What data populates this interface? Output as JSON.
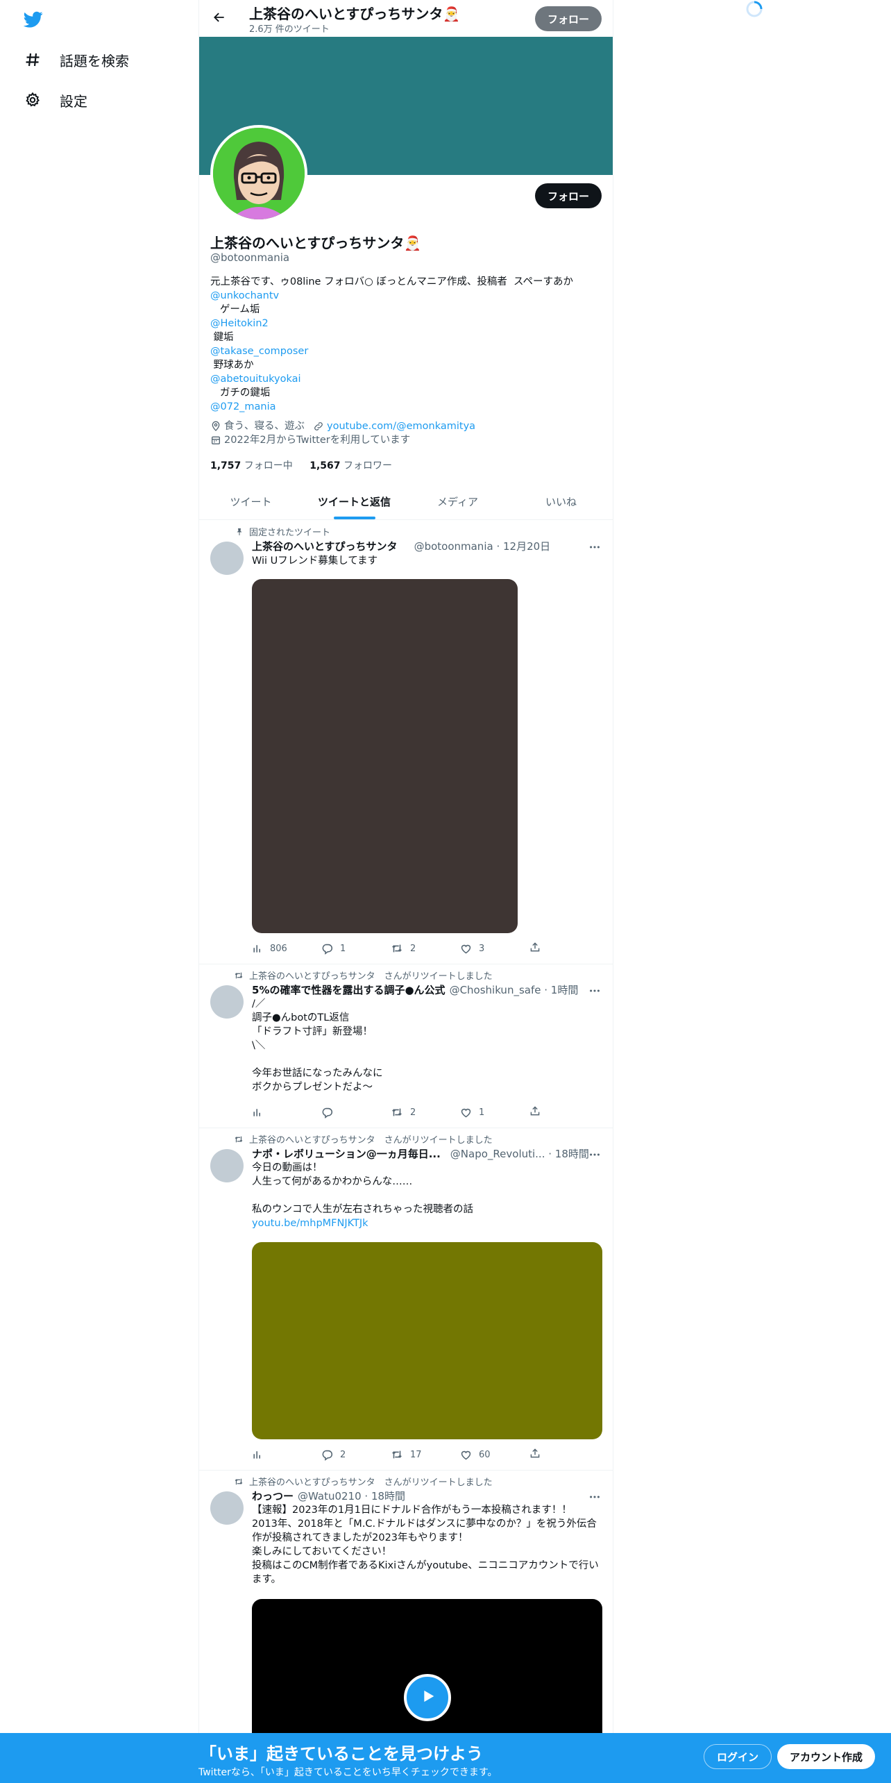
{
  "nav": {
    "items": [
      {
        "label": "話題を検索",
        "icon": "hashtag-icon"
      },
      {
        "label": "設定",
        "icon": "gear-icon"
      }
    ]
  },
  "header": {
    "name": "上茶谷のへいとすぴっちサンタ🎅",
    "tweet_count": "2.6万 件のツイート",
    "follow_label": "フォロー"
  },
  "profile": {
    "follow_label": "フォロー",
    "name": "上茶谷のへいとすぴっちサンタ🎅",
    "handle": "@botoonmania",
    "bio": {
      "line1": "元上茶谷です、ゥ08line フォロバ○ ぼっとんマニア作成、投稿者  スペーすあか",
      "link1": "@unkochantv",
      "text1": "   ゲーム垢",
      "link2": "@Heitokin2",
      "text2": " 鍵垢",
      "link3": "@takase_composer",
      "text3": " 野球あか",
      "link4": "@abetouitukyokai",
      "text4": "   ガチの鍵垢",
      "link5": "@072_mania"
    },
    "location": "食う、寝る、遊ぶ",
    "url": "youtube.com/@emonkamitya",
    "joined": "2022年2月からTwitterを利用しています",
    "following_count": "1,757",
    "following_label": "フォロー中",
    "followers_count": "1,567",
    "followers_label": "フォロワー"
  },
  "tabs": [
    {
      "label": "ツイート",
      "active": false
    },
    {
      "label": "ツイートと返信",
      "active": true
    },
    {
      "label": "メディア",
      "active": false
    },
    {
      "label": "いいね",
      "active": false
    }
  ],
  "tweets": [
    {
      "context": "固定されたツイート",
      "name": "上茶谷のへいとすぴっちサンタ",
      "handle": "@botoonmania",
      "time": "12月20日",
      "lines": [
        "Wii Uフレンド募集してます"
      ],
      "media_color": "#3e3533",
      "views": "806",
      "replies": "1",
      "retweets": "2",
      "likes": "3"
    },
    {
      "context": "上茶谷のへいとすぴっちサンタ　さんがリツイートしました",
      "name": "5%の確率で性器を露出する調子●ん公式",
      "handle": "@Choshikun_safe",
      "time": "1時間",
      "lines": [
        "/／",
        "調子●んbotのTL返信",
        "「ドラフト寸評」新登場！",
        "\\＼",
        "",
        "今年お世話になったみんなに",
        "ボクからプレゼントだよ〜"
      ],
      "views": "",
      "replies": "",
      "retweets": "2",
      "likes": "1"
    },
    {
      "context": "上茶谷のへいとすぴっちサンタ　さんがリツイートしました",
      "name": "ナポ・レボリューション@一ヵ月毎日...",
      "handle": "@Napo_Revoluti...",
      "time": "18時間",
      "lines": [
        "今日の動画は！",
        "人生って何があるかわからんな……",
        "",
        "私のウンコで人生が左右されちゃった視聴者の話"
      ],
      "link": "youtu.be/mhpMFNJKTJk",
      "media_color": "#737702",
      "views": "",
      "replies": "2",
      "retweets": "17",
      "likes": "60"
    },
    {
      "context": "上茶谷のへいとすぴっちサンタ　さんがリツイートしました",
      "name": "わっつー",
      "handle": "@Watu0210",
      "time": "18時間",
      "lines": [
        "【速報】2023年の1月1日にドナルド合作がもう一本投稿されます！！",
        "2013年、2018年と「M.C.ドナルドはダンスに夢中なのか？」を祝う外伝合",
        "作が投稿されてきましたが2023年もやります！",
        "楽しみにしておいてください！",
        "投稿はこのCM制作者であるKixiさんがyoutube、ニコニコアカウントで行い",
        "ます。"
      ],
      "media_color": "#000000"
    }
  ],
  "bottom": {
    "title": "「いま」起きていることを見つけよう",
    "subtitle": "Twitterなら、「いま」起きていることをいち早くチェックできます。",
    "login_label": "ログイン",
    "signup_label": "アカウント作成"
  },
  "colors": {
    "accent": "#1d9bf0",
    "banner": "#277b81"
  }
}
